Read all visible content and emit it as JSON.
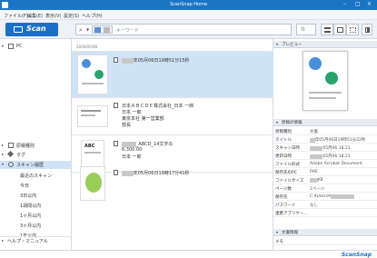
{
  "app": {
    "title": "ScanSnap Home"
  },
  "menu": {
    "items": [
      "ファイル(F)",
      "編集(E)",
      "表示(V)",
      "設定(S)",
      "ヘルプ(H)"
    ]
  },
  "toolbar": {
    "scan_label": "Scan",
    "search_placeholder": "キーワード",
    "brand_color": "#1a6fc8"
  },
  "sidebar": {
    "pc_label": "PC",
    "items": [
      {
        "label": "原稿種別",
        "icon": "document-type-icon"
      },
      {
        "label": "タグ",
        "icon": "tag-icon"
      },
      {
        "label": "スキャン履歴",
        "icon": "history-icon"
      }
    ],
    "history_items": [
      "最近のスキャン",
      "今日",
      "3日以内",
      "1週間以内",
      "1ヶ月以内",
      "3ヶ月以内",
      "1年以内"
    ],
    "help_label": "ヘルプ・マニュアル"
  },
  "main": {
    "date_header": "2020/05/06",
    "rows": [
      {
        "title": "年05月06日19時51分15秒",
        "type": "document"
      },
      {
        "title": "日本ＡＢＣＤＥ株式会社_日本 一郎",
        "line2": "日本 一郎",
        "line3": "東京本社 第一営業部",
        "line4": "部長",
        "type": "business-card"
      },
      {
        "title": "_ABCD_14文字の",
        "line2": "6,300.00",
        "line3": "日本 一郎",
        "type": "receipt"
      },
      {
        "title": "年05月06日19時17分41秒",
        "type": "photo"
      }
    ]
  },
  "right": {
    "preview_header": "プレビュー",
    "info_header": "原稿の情報",
    "info_rows": [
      {
        "k": "原稿種別",
        "v": "文書"
      },
      {
        "k": "タイトル",
        "v": "年05月06日19時51分22秒"
      },
      {
        "k": "スキャン日時",
        "v": "05月06 18:21"
      },
      {
        "k": "更新日時",
        "v": "05月06 18:21"
      },
      {
        "k": "ファイル形式",
        "v": "Adobe Acrobat Document"
      },
      {
        "k": "保存先のPC",
        "v": "PHE"
      },
      {
        "k": "ファイルサイズ",
        "v": "KB"
      },
      {
        "k": "ページ数",
        "v": "1ページ"
      },
      {
        "k": "保存先",
        "v": "C:¥Users¥"
      },
      {
        "k": "パスワード",
        "v": "なし"
      },
      {
        "k": "連携アプリケー…",
        "v": ""
      }
    ],
    "cloud_header": "文書情報",
    "memo_label": "メモ"
  },
  "footer": {
    "logo": "ScanSnap"
  }
}
